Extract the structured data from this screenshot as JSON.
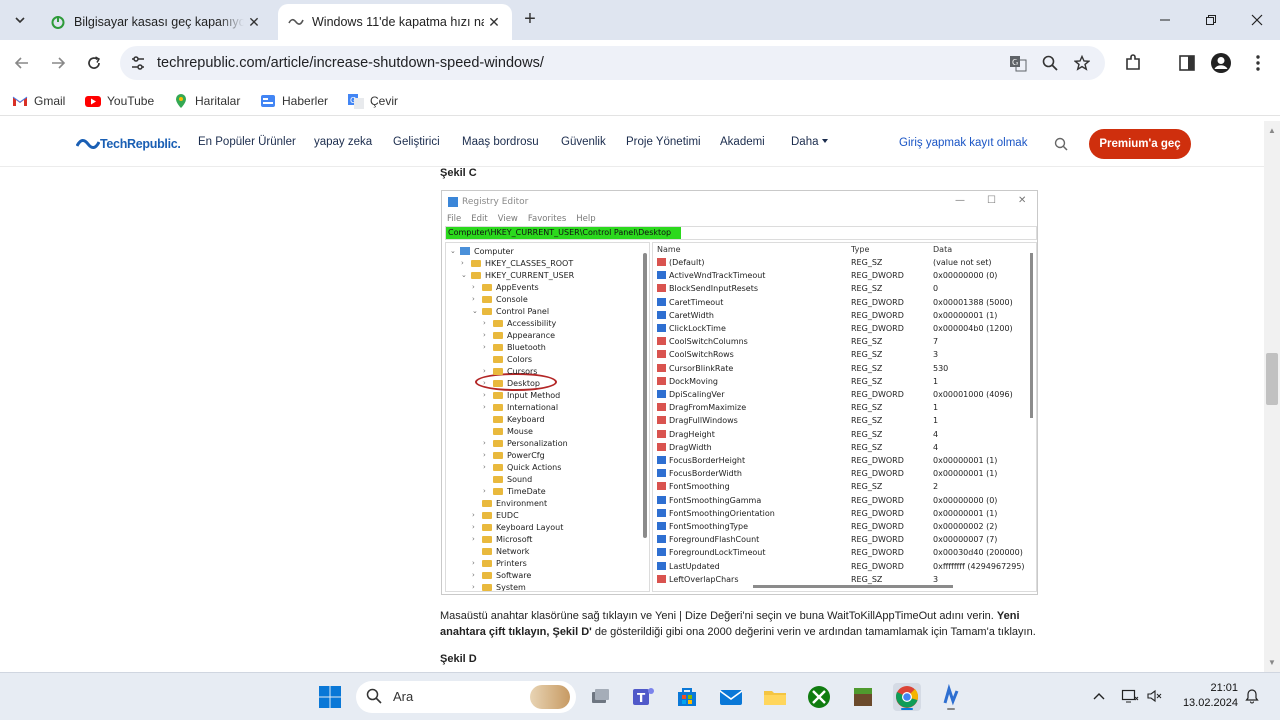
{
  "browser": {
    "tabs": [
      {
        "title": "Bilgisayar kasası geç kapanıyor",
        "active": false
      },
      {
        "title": "Windows 11'de kapatma hızı na",
        "active": true
      }
    ],
    "url": "techrepublic.com/article/increase-shutdown-speed-windows/",
    "bookmarks": [
      {
        "label": "Gmail",
        "icon": "gmail-icon"
      },
      {
        "label": "YouTube",
        "icon": "youtube-icon"
      },
      {
        "label": "Haritalar",
        "icon": "maps-icon"
      },
      {
        "label": "Haberler",
        "icon": "news-icon"
      },
      {
        "label": "Çevir",
        "icon": "translate-icon"
      }
    ]
  },
  "site": {
    "logo": "TechRepublic.",
    "nav": [
      "En Popüler Ürünler",
      "yapay zeka",
      "Geliştirici",
      "Maaş bordrosu",
      "Güvenlik",
      "Proje Yönetimi",
      "Akademi",
      "Daha"
    ],
    "login": "Giriş yapmak kayıt olmak",
    "premium": "Premium'a geç"
  },
  "article": {
    "figure_c": "Şekil C",
    "figure_d": "Şekil D",
    "para_plain_1": "Masaüstü anahtar klasörüne sağ tıklayın ve Yeni | Dize Değeri'ni seçin ve buna WaitToKillAppTimeOut adını verin.",
    "para_bold_1": "Yeni anahtara çift tıklayın, Şekil D'",
    "para_plain_2": "de gösterildiği gibi ona 2000 değerini verin ve ardından tamamlamak için Tamam'a tıklayın."
  },
  "regedit": {
    "title": "Registry Editor",
    "menu": [
      "File",
      "Edit",
      "View",
      "Favorites",
      "Help"
    ],
    "address": "Computer\\HKEY_CURRENT_USER\\Control Panel\\Desktop",
    "tree": [
      {
        "label": "Computer",
        "depth": 0,
        "expanded": true,
        "pc": true
      },
      {
        "label": "HKEY_CLASSES_ROOT",
        "depth": 1,
        "expanded": false
      },
      {
        "label": "HKEY_CURRENT_USER",
        "depth": 1,
        "expanded": true
      },
      {
        "label": "AppEvents",
        "depth": 2,
        "expanded": false
      },
      {
        "label": "Console",
        "depth": 2,
        "expanded": false
      },
      {
        "label": "Control Panel",
        "depth": 2,
        "expanded": true
      },
      {
        "label": "Accessibility",
        "depth": 3,
        "expanded": false
      },
      {
        "label": "Appearance",
        "depth": 3,
        "expanded": false
      },
      {
        "label": "Bluetooth",
        "depth": 3,
        "expanded": false
      },
      {
        "label": "Colors",
        "depth": 3,
        "leaf": true
      },
      {
        "label": "Cursors",
        "depth": 3,
        "expanded": false
      },
      {
        "label": "Desktop",
        "depth": 3,
        "expanded": false,
        "selected": true
      },
      {
        "label": "Input Method",
        "depth": 3,
        "expanded": false
      },
      {
        "label": "International",
        "depth": 3,
        "expanded": false
      },
      {
        "label": "Keyboard",
        "depth": 3,
        "leaf": true
      },
      {
        "label": "Mouse",
        "depth": 3,
        "leaf": true
      },
      {
        "label": "Personalization",
        "depth": 3,
        "expanded": false
      },
      {
        "label": "PowerCfg",
        "depth": 3,
        "expanded": false
      },
      {
        "label": "Quick Actions",
        "depth": 3,
        "expanded": false
      },
      {
        "label": "Sound",
        "depth": 3,
        "leaf": true
      },
      {
        "label": "TimeDate",
        "depth": 3,
        "expanded": false
      },
      {
        "label": "Environment",
        "depth": 2,
        "leaf": true
      },
      {
        "label": "EUDC",
        "depth": 2,
        "expanded": false
      },
      {
        "label": "Keyboard Layout",
        "depth": 2,
        "expanded": false
      },
      {
        "label": "Microsoft",
        "depth": 2,
        "expanded": false
      },
      {
        "label": "Network",
        "depth": 2,
        "leaf": true
      },
      {
        "label": "Printers",
        "depth": 2,
        "expanded": false
      },
      {
        "label": "Software",
        "depth": 2,
        "expanded": false
      },
      {
        "label": "System",
        "depth": 2,
        "expanded": false
      }
    ],
    "columns": [
      "Name",
      "Type",
      "Data"
    ],
    "values": [
      {
        "name": "(Default)",
        "type": "REG_SZ",
        "data": "(value not set)"
      },
      {
        "name": "ActiveWndTrackTimeout",
        "type": "REG_DWORD",
        "data": "0x00000000 (0)"
      },
      {
        "name": "BlockSendInputResets",
        "type": "REG_SZ",
        "data": "0"
      },
      {
        "name": "CaretTimeout",
        "type": "REG_DWORD",
        "data": "0x00001388 (5000)"
      },
      {
        "name": "CaretWidth",
        "type": "REG_DWORD",
        "data": "0x00000001 (1)"
      },
      {
        "name": "ClickLockTime",
        "type": "REG_DWORD",
        "data": "0x000004b0 (1200)"
      },
      {
        "name": "CoolSwitchColumns",
        "type": "REG_SZ",
        "data": "7"
      },
      {
        "name": "CoolSwitchRows",
        "type": "REG_SZ",
        "data": "3"
      },
      {
        "name": "CursorBlinkRate",
        "type": "REG_SZ",
        "data": "530"
      },
      {
        "name": "DockMoving",
        "type": "REG_SZ",
        "data": "1"
      },
      {
        "name": "DpiScalingVer",
        "type": "REG_DWORD",
        "data": "0x00001000 (4096)"
      },
      {
        "name": "DragFromMaximize",
        "type": "REG_SZ",
        "data": "1"
      },
      {
        "name": "DragFullWindows",
        "type": "REG_SZ",
        "data": "1"
      },
      {
        "name": "DragHeight",
        "type": "REG_SZ",
        "data": "4"
      },
      {
        "name": "DragWidth",
        "type": "REG_SZ",
        "data": "4"
      },
      {
        "name": "FocusBorderHeight",
        "type": "REG_DWORD",
        "data": "0x00000001 (1)"
      },
      {
        "name": "FocusBorderWidth",
        "type": "REG_DWORD",
        "data": "0x00000001 (1)"
      },
      {
        "name": "FontSmoothing",
        "type": "REG_SZ",
        "data": "2"
      },
      {
        "name": "FontSmoothingGamma",
        "type": "REG_DWORD",
        "data": "0x00000000 (0)"
      },
      {
        "name": "FontSmoothingOrientation",
        "type": "REG_DWORD",
        "data": "0x00000001 (1)"
      },
      {
        "name": "FontSmoothingType",
        "type": "REG_DWORD",
        "data": "0x00000002 (2)"
      },
      {
        "name": "ForegroundFlashCount",
        "type": "REG_DWORD",
        "data": "0x00000007 (7)"
      },
      {
        "name": "ForegroundLockTimeout",
        "type": "REG_DWORD",
        "data": "0x00030d40 (200000)"
      },
      {
        "name": "LastUpdated",
        "type": "REG_DWORD",
        "data": "0xffffffff (4294967295)"
      },
      {
        "name": "LeftOverlapChars",
        "type": "REG_SZ",
        "data": "3"
      }
    ]
  },
  "taskbar": {
    "search": "Ara",
    "time": "21:01",
    "date": "13.02.2024"
  },
  "colors": {
    "premium": "#cf2f0d",
    "link": "#1a55c5",
    "address_highlight": "#2bd91d",
    "selection_circle": "#b32626"
  }
}
